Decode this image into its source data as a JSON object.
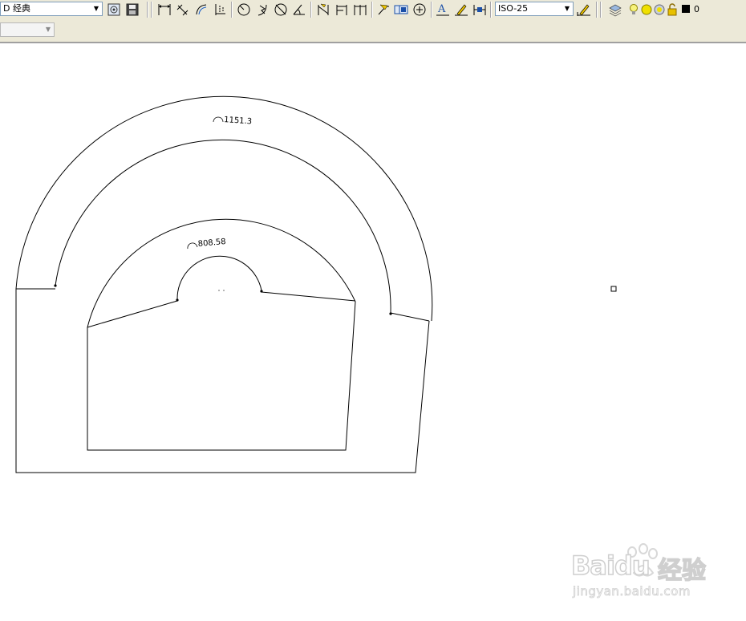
{
  "toolbar": {
    "workspace_value": "D 经典",
    "dimstyle_value": "ISO-25",
    "layer_value": "0",
    "layer_color": "#000000",
    "layer_lamp_color": "#e8e000"
  },
  "toolbar2": {
    "combo_value": ""
  },
  "drawing": {
    "dim_outer": "1151.3",
    "dim_inner": "808.58",
    "line_color": "#000000"
  },
  "watermark": {
    "brand": "Baidu",
    "brand_cn": "经验",
    "url": "jingyan.baidu.com"
  }
}
